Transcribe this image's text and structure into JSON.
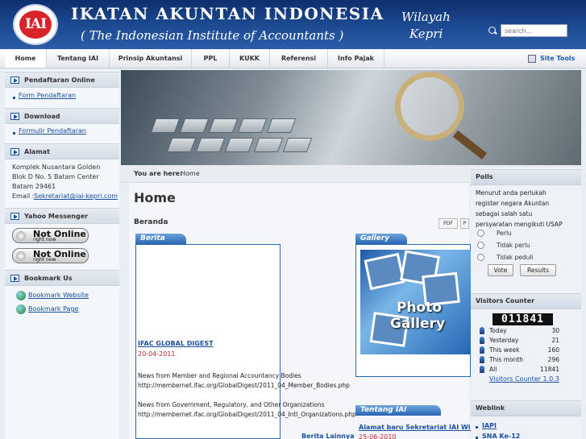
{
  "header": {
    "logo_text": "IAI",
    "title": "IKATAN AKUNTAN INDONESIA",
    "subtitle": "( The Indonesian Institute of Accountants )",
    "region_line1": "Wilayah",
    "region_line2": "Kepri",
    "search_placeholder": "search..."
  },
  "nav": {
    "items": [
      "Home",
      "Tentang IAI",
      "Prinsip Akuntansi",
      "PPL",
      "KUKK",
      "Referensi",
      "Info Pajak"
    ],
    "active": "Home",
    "site_tools": "Site Tools"
  },
  "left": {
    "pendaftaran": {
      "title": "Pendaftaran Online",
      "link": "Form Pendaftaran"
    },
    "download": {
      "title": "Download",
      "link": "Formulir Pendaftaran"
    },
    "alamat": {
      "title": "Alamat",
      "lines": [
        "Komplek Nusantara Golden",
        "Blok D No. 5 Batam Center",
        "Batam 29461"
      ],
      "email_label": "Email :",
      "email": "Sekretariat@iai-kepri.com"
    },
    "yahoo": {
      "title": "Yahoo Messenger",
      "status": "Not Online",
      "status_sub": "right now"
    },
    "bookmark": {
      "title": "Bookmark Us",
      "links": [
        "Bookmark Website",
        "Bookmark Page"
      ]
    }
  },
  "main": {
    "breadcrumb_label": "You are here:",
    "breadcrumb": "Home",
    "page_title": "Home",
    "section_title": "Beranda",
    "pdf_label": "PDF",
    "print_label": "P",
    "berita": {
      "tab": "Berita",
      "title": "IFAC GLOBAL DIGEST",
      "date": "20-04-2011",
      "p1_line1": "News from Member and Regional Accountancy Bodies",
      "p1_line2": "http://membernet.ifac.org/GlobalDigest/2011_04_Member_Bodies.php",
      "p2_line1": "News from Government, Regulatory, and Other Organizations",
      "p2_line2": "http://membernet.ifac.org/GlobalDigest/2011_04_Intl_Organizations.php",
      "more": "Berita Lainnya"
    },
    "gallery": {
      "tab": "Gallery",
      "image_line1": "Photo",
      "image_line2": "Gallery"
    },
    "tentang": {
      "tab": "Tentang IAI",
      "title": "Alamat baru Sekretariat IAI Wil Ke",
      "date": "25-06-2010"
    }
  },
  "right": {
    "polls": {
      "title": "Polls",
      "question_lines": [
        "Menurut anda perlukah",
        "register negara Akuntan",
        "sebagai salah satu",
        "persyaratan mengikuti USAP"
      ],
      "options": [
        "Perlu",
        "Tidak perlu",
        "Tidak peduli"
      ],
      "vote": "Vote",
      "results": "Results"
    },
    "visitors": {
      "title": "Visitors Counter",
      "counter": "011841",
      "rows": [
        {
          "label": "Today",
          "value": "30"
        },
        {
          "label": "Yesterday",
          "value": "21"
        },
        {
          "label": "This week",
          "value": "160"
        },
        {
          "label": "This month",
          "value": "296"
        },
        {
          "label": "All",
          "value": "11841"
        }
      ],
      "link": "Visitors Counter 1.0.3"
    },
    "weblink": {
      "title": "Weblink",
      "links": [
        "IAPI",
        "SNA Ke-12"
      ]
    }
  }
}
